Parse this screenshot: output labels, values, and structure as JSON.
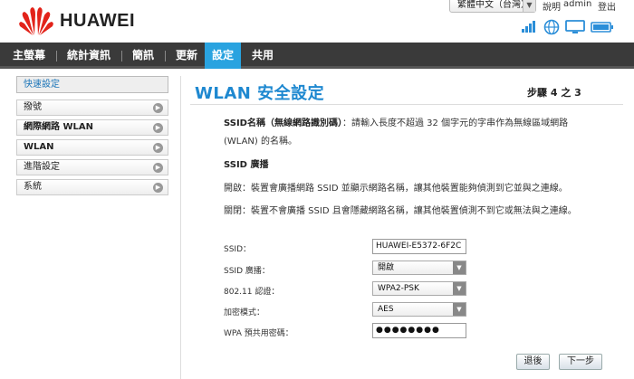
{
  "header": {
    "brand": "HUAWEI",
    "language": "繁體中文（台灣）",
    "help": "說明",
    "user": "admin",
    "logout": "登出"
  },
  "nav": {
    "items": [
      "主螢幕",
      "統計資訊",
      "簡訊",
      "更新",
      "設定",
      "共用"
    ],
    "active": "設定"
  },
  "sidebar": {
    "quick_setup": "快速設定",
    "items": [
      "撥號",
      "網際網路 WLAN",
      "WLAN",
      "進階設定",
      "系統"
    ]
  },
  "main": {
    "title": "WLAN 安全設定",
    "step": "步驟 4 之 3",
    "ssid_name_label": "SSID名稱（無線網路識別碼）",
    "ssid_name_desc": "：請輸入長度不超過 32 個字元的字串作為無線區域網路",
    "ssid_name_desc2": "(WLAN) 的名稱。",
    "ssid_broadcast_heading": "SSID 廣播",
    "enable_text": "開啟：裝置會廣播網路 SSID 並顯示網路名稱，讓其他裝置能夠偵測到它並與之連線。",
    "disable_text": "關閉：裝置不會廣播 SSID 且會隱藏網路名稱，讓其他裝置偵測不到它或無法與之連線。"
  },
  "form": {
    "ssid_label": "SSID：",
    "ssid_value": "HUAWEI-E5372-6F2C",
    "broadcast_label": "SSID 廣播：",
    "broadcast_value": "開啟",
    "auth_label": "802.11 認證：",
    "auth_value": "WPA2-PSK",
    "enc_label": "加密模式：",
    "enc_value": "AES",
    "psk_label": "WPA 預共用密碼：",
    "psk_value": "●●●●●●●●"
  },
  "buttons": {
    "back": "退後",
    "next": "下一步"
  },
  "colors": {
    "accent": "#29a3e0",
    "title": "#1e88d0",
    "nav_bg": "#3a3a3a"
  }
}
